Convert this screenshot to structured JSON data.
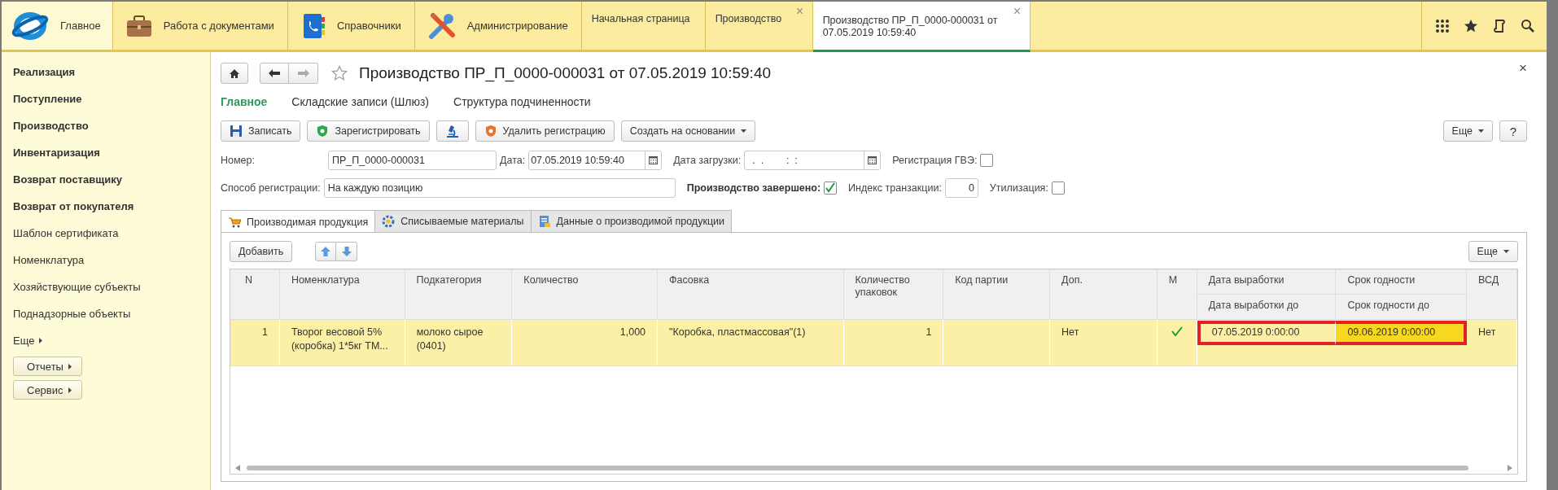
{
  "top_bar": {
    "sections": [
      {
        "label": "Главное",
        "selected": true
      },
      {
        "label": "Работа с документами",
        "selected": false
      },
      {
        "label": "Справочники",
        "selected": false
      },
      {
        "label": "Администрирование",
        "selected": false
      }
    ],
    "open_windows": [
      {
        "label": "Начальная страница",
        "closable": false,
        "selected": false
      },
      {
        "label": "Производство",
        "closable": true,
        "selected": false
      },
      {
        "label": "Производство ПР_П_0000-000031 от 07.05.2019 10:59:40",
        "closable": true,
        "selected": true
      }
    ]
  },
  "sidebar": {
    "items": [
      {
        "label": "Реализация",
        "kind": "group"
      },
      {
        "label": "Поступление",
        "kind": "group"
      },
      {
        "label": "Производство",
        "kind": "group"
      },
      {
        "label": "Инвентаризация",
        "kind": "group"
      },
      {
        "label": "Возврат поставщику",
        "kind": "group"
      },
      {
        "label": "Возврат от покупателя",
        "kind": "group"
      },
      {
        "label": "Шаблон сертификата",
        "kind": "link"
      },
      {
        "label": "Номенклатура",
        "kind": "link"
      },
      {
        "label": "Хозяйствующие субъекты",
        "kind": "link"
      },
      {
        "label": "Поднадзорные объекты",
        "kind": "link"
      }
    ],
    "more": "Еще",
    "buttons": [
      "Отчеты",
      "Сервис"
    ]
  },
  "form": {
    "title": "Производство ПР_П_0000-000031 от 07.05.2019 10:59:40",
    "close": "×",
    "links": [
      {
        "label": "Главное",
        "selected": true
      },
      {
        "label": "Складские записи (Шлюз)",
        "selected": false
      },
      {
        "label": "Структура подчиненности",
        "selected": false
      }
    ],
    "commands": [
      {
        "label": "Записать",
        "kind": "button"
      },
      {
        "label": "Зарегистрировать",
        "kind": "button"
      },
      {
        "kind": "icon"
      },
      {
        "label": "Удалить регистрацию",
        "kind": "button"
      },
      {
        "label": "Создать на основании",
        "kind": "menu"
      }
    ],
    "more": "Еще",
    "help": "?",
    "number": {
      "label": "Номер:",
      "value": "ПР_П_0000-000031"
    },
    "date": {
      "label": "Дата:",
      "value": "07.05.2019 10:59:40"
    },
    "load_date": {
      "label": "Дата загрузки:",
      "value": "  .  .        :  :"
    },
    "gve": {
      "label": "Регистрация ГВЭ:",
      "checked": false
    },
    "method": {
      "label": "Способ регистрации:",
      "value": "На каждую позицию"
    },
    "finished": {
      "label": "Производство завершено:",
      "checked": true
    },
    "transaction_index": {
      "label": "Индекс транзакции:",
      "value": "0"
    },
    "disposal": {
      "label": "Утилизация:",
      "checked": false
    },
    "tabs": [
      {
        "label": "Производимая продукция",
        "selected": true
      },
      {
        "label": "Списываемые материалы",
        "selected": false
      },
      {
        "label": "Данные о производимой продукции",
        "selected": false
      }
    ],
    "table_toolbar": {
      "add": "Добавить",
      "more": "Еще"
    },
    "table": {
      "columns": [
        {
          "title": "N"
        },
        {
          "title": "Номенклатура"
        },
        {
          "title": "Подкатегория"
        },
        {
          "title": "Количество"
        },
        {
          "title": "Фасовка"
        },
        {
          "title": "Количество упаковок"
        },
        {
          "title": "Код партии"
        },
        {
          "title": "Доп."
        },
        {
          "title": "М"
        },
        {
          "title": "Дата выработки",
          "subtitle": "Дата выработки до"
        },
        {
          "title": "Срок годности",
          "subtitle": "Срок годности до"
        },
        {
          "title": "ВСД"
        }
      ],
      "rows": [
        {
          "selected": true,
          "cells": [
            {
              "kind": "text",
              "text": "1"
            },
            {
              "kind": "text",
              "text": "Творог весовой 5% (коробка) 1*5кг ТМ..."
            },
            {
              "kind": "text",
              "text": "молоко сырое (0401)"
            },
            {
              "kind": "text",
              "text": "1,000"
            },
            {
              "kind": "text",
              "text": "\"Коробка, пластмассовая\"(1)"
            },
            {
              "kind": "text",
              "text": "1"
            },
            {
              "kind": "empty"
            },
            {
              "kind": "text",
              "text": "Нет"
            },
            {
              "kind": "check",
              "checked": true
            },
            {
              "kind": "text",
              "text": "07.05.2019 0:00:00",
              "framed": true
            },
            {
              "kind": "text",
              "text": "09.06.2019 0:00:00",
              "framed": true,
              "selected": true
            },
            {
              "kind": "text",
              "text": "Нет"
            }
          ]
        }
      ]
    }
  }
}
